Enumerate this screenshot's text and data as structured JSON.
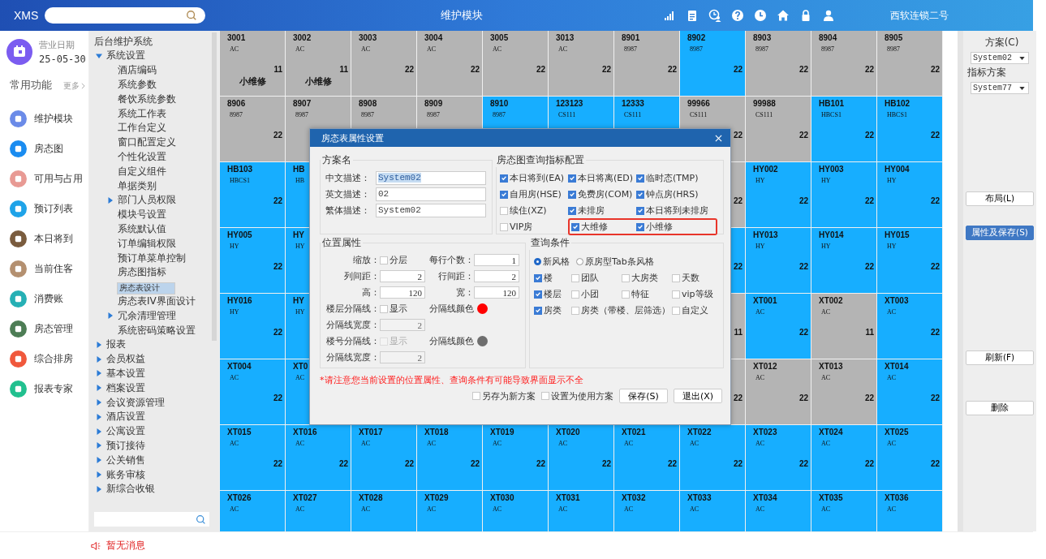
{
  "header": {
    "logo": "XMS",
    "title": "维护模块",
    "user": "西软连锁二号"
  },
  "business_date": {
    "label": "营业日期",
    "value": "25-05-30"
  },
  "shortcuts": {
    "title": "常用功能",
    "more": "更多",
    "items": [
      {
        "label": "维护模块",
        "color": "#6b8be8"
      },
      {
        "label": "房态图",
        "color": "#1a8cf0"
      },
      {
        "label": "可用与占用",
        "color": "#e89a94"
      },
      {
        "label": "预订列表",
        "color": "#1fa3e8"
      },
      {
        "label": "本日将到",
        "color": "#7a5c3e"
      },
      {
        "label": "当前住客",
        "color": "#b49070"
      },
      {
        "label": "消费账",
        "color": "#26b0b5"
      },
      {
        "label": "房态管理",
        "color": "#4d7d55"
      },
      {
        "label": "综合排房",
        "color": "#f0583c"
      },
      {
        "label": "报表专家",
        "color": "#22c08f"
      }
    ]
  },
  "tree": {
    "root": "后台维护系统",
    "items": [
      {
        "label": "系统设置",
        "kind": "branch",
        "expanded": true,
        "selected": false,
        "children": [
          {
            "label": "酒店编码",
            "kind": "leaf",
            "selected": false
          },
          {
            "label": "系统参数",
            "kind": "leaf",
            "selected": false
          },
          {
            "label": "餐饮系统参数",
            "kind": "leaf",
            "selected": false
          },
          {
            "label": "系统工作表",
            "kind": "leaf",
            "selected": false
          },
          {
            "label": "工作台定义",
            "kind": "leaf",
            "selected": false
          },
          {
            "label": "窗口配置定义",
            "kind": "leaf",
            "selected": false
          },
          {
            "label": "个性化设置",
            "kind": "leaf",
            "selected": false
          },
          {
            "label": "自定义组件",
            "kind": "leaf",
            "selected": false
          },
          {
            "label": "单据类别",
            "kind": "leaf",
            "selected": false
          },
          {
            "label": "部门人员权限",
            "kind": "branch",
            "expanded": false,
            "selected": false
          },
          {
            "label": "模块号设置",
            "kind": "leaf",
            "selected": false
          },
          {
            "label": "系统默认值",
            "kind": "leaf",
            "selected": false
          },
          {
            "label": "订单编辑权限",
            "kind": "leaf",
            "selected": false
          },
          {
            "label": "预订单菜单控制",
            "kind": "leaf",
            "selected": false
          },
          {
            "label": "房态图指标",
            "kind": "leaf",
            "selected": false
          },
          {
            "label": "房态表设计",
            "kind": "leaf",
            "selected": true
          },
          {
            "label": "房态表IV界面设计",
            "kind": "leaf",
            "selected": false
          },
          {
            "label": "冗余清理管理",
            "kind": "branch",
            "expanded": false,
            "selected": false
          },
          {
            "label": "系统密码策略设置",
            "kind": "leaf",
            "selected": false
          }
        ]
      },
      {
        "label": "报表",
        "kind": "branch",
        "expanded": false,
        "selected": false
      },
      {
        "label": "会员权益",
        "kind": "branch",
        "expanded": false,
        "selected": false
      },
      {
        "label": "基本设置",
        "kind": "branch",
        "expanded": false,
        "selected": false
      },
      {
        "label": "档案设置",
        "kind": "branch",
        "expanded": false,
        "selected": false
      },
      {
        "label": "会议资源管理",
        "kind": "branch",
        "expanded": false,
        "selected": false
      },
      {
        "label": "酒店设置",
        "kind": "branch",
        "expanded": false,
        "selected": false
      },
      {
        "label": "公寓设置",
        "kind": "branch",
        "expanded": false,
        "selected": false
      },
      {
        "label": "预订接待",
        "kind": "branch",
        "expanded": false,
        "selected": false
      },
      {
        "label": "公关销售",
        "kind": "branch",
        "expanded": false,
        "selected": false
      },
      {
        "label": "账务审核",
        "kind": "branch",
        "expanded": false,
        "selected": false
      },
      {
        "label": "新综合收银",
        "kind": "branch",
        "expanded": false,
        "selected": false
      }
    ]
  },
  "grid": {
    "rows": [
      [
        {
          "name": "3001",
          "code": "AC",
          "number": "11",
          "note": "小维修",
          "color": "#b4b4b4"
        },
        {
          "name": "3002",
          "code": "AC",
          "number": "11",
          "note": "小维修",
          "color": "#b4b4b4"
        },
        {
          "name": "3003",
          "code": "AC",
          "number": "22",
          "color": "#b4b4b4"
        },
        {
          "name": "3004",
          "code": "AC",
          "number": "22",
          "color": "#b4b4b4"
        },
        {
          "name": "3005",
          "code": "AC",
          "number": "22",
          "color": "#b4b4b4"
        },
        {
          "name": "3013",
          "code": "AC",
          "number": "22",
          "color": "#b4b4b4"
        },
        {
          "name": "8901",
          "code": "8987",
          "number": "22",
          "color": "#b4b4b4"
        },
        {
          "name": "8902",
          "code": "8987",
          "number": "22",
          "color": "#17aeff"
        },
        {
          "name": "8903",
          "code": "8987",
          "number": "22",
          "color": "#b4b4b4"
        },
        {
          "name": "8904",
          "code": "8987",
          "number": "22",
          "color": "#b4b4b4"
        },
        {
          "name": "8905",
          "code": "8987",
          "number": "22",
          "color": "#b4b4b4"
        }
      ],
      [
        {
          "name": "8906",
          "code": "8987",
          "number": "22",
          "color": "#b4b4b4"
        },
        {
          "name": "8907",
          "code": "8987",
          "color": "#b4b4b4"
        },
        {
          "name": "8908",
          "code": "8987",
          "color": "#b4b4b4"
        },
        {
          "name": "8909",
          "code": "8987",
          "color": "#b4b4b4"
        },
        {
          "name": "8910",
          "code": "8987",
          "color": "#17aeff"
        },
        {
          "name": "123123",
          "code": "CS111",
          "color": "#17aeff"
        },
        {
          "name": "12333",
          "code": "CS111",
          "color": "#17aeff"
        },
        {
          "name": "99966",
          "code": "CS111",
          "number": "22",
          "color": "#b4b4b4"
        },
        {
          "name": "99988",
          "code": "CS111",
          "number": "22",
          "color": "#b4b4b4"
        },
        {
          "name": "HB101",
          "code": "HBCS1",
          "number": "22",
          "color": "#17aeff"
        },
        {
          "name": "HB102",
          "code": "HBCS1",
          "number": "22",
          "color": "#17aeff"
        }
      ],
      [
        {
          "name": "HB103",
          "code": "HBCS1",
          "number": "22",
          "color": "#17aeff"
        },
        {
          "name": "HB",
          "code": "HB",
          "color": "#17aeff"
        },
        {},
        {},
        {},
        {},
        {},
        {
          "number": "22",
          "color": "#b4b4b4"
        },
        {
          "name": "HY002",
          "code": "HY",
          "number": "22",
          "color": "#17aeff"
        },
        {
          "name": "HY003",
          "code": "HY",
          "number": "22",
          "color": "#17aeff"
        },
        {
          "name": "HY004",
          "code": "HY",
          "number": "22",
          "color": "#17aeff"
        }
      ],
      [
        {
          "name": "HY005",
          "code": "HY",
          "number": "22",
          "color": "#17aeff"
        },
        {
          "name": "HY",
          "code": "HY",
          "color": "#17aeff"
        },
        {},
        {},
        {},
        {},
        {},
        {
          "number": "22",
          "color": "#17aeff"
        },
        {
          "name": "HY013",
          "code": "HY",
          "number": "22",
          "color": "#17aeff"
        },
        {
          "name": "HY014",
          "code": "HY",
          "number": "22",
          "color": "#17aeff"
        },
        {
          "name": "HY015",
          "code": "HY",
          "number": "22",
          "color": "#17aeff"
        }
      ],
      [
        {
          "name": "HY016",
          "code": "HY",
          "number": "22",
          "color": "#17aeff"
        },
        {
          "name": "HY",
          "code": "HY",
          "color": "#17aeff"
        },
        {},
        {},
        {},
        {},
        {},
        {
          "number": "11",
          "color": "#b4b4b4"
        },
        {
          "name": "XT001",
          "code": "AC",
          "number": "22",
          "color": "#17aeff"
        },
        {
          "name": "XT002",
          "code": "AC",
          "number": "11",
          "color": "#b4b4b4"
        },
        {
          "name": "XT003",
          "code": "AC",
          "number": "22",
          "color": "#17aeff"
        }
      ],
      [
        {
          "name": "XT004",
          "code": "AC",
          "number": "22",
          "color": "#17aeff"
        },
        {
          "name": "XT0",
          "code": "AC",
          "color": "#17aeff"
        },
        {},
        {},
        {},
        {},
        {},
        {
          "number": "22",
          "color": "#b4b4b4"
        },
        {
          "name": "XT012",
          "code": "AC",
          "number": "22",
          "color": "#b4b4b4"
        },
        {
          "name": "XT013",
          "code": "AC",
          "number": "22",
          "color": "#b4b4b4"
        },
        {
          "name": "XT014",
          "code": "AC",
          "number": "22",
          "color": "#17aeff"
        }
      ],
      [
        {
          "name": "XT015",
          "code": "AC",
          "number": "22",
          "color": "#17aeff"
        },
        {
          "name": "XT016",
          "code": "AC",
          "number": "22",
          "color": "#17aeff"
        },
        {
          "name": "XT017",
          "code": "AC",
          "number": "22",
          "color": "#17aeff"
        },
        {
          "name": "XT018",
          "code": "AC",
          "number": "22",
          "color": "#17aeff"
        },
        {
          "name": "XT019",
          "code": "AC",
          "number": "22",
          "color": "#17aeff"
        },
        {
          "name": "XT020",
          "code": "AC",
          "number": "22",
          "color": "#17aeff"
        },
        {
          "name": "XT021",
          "code": "AC",
          "number": "22",
          "color": "#17aeff"
        },
        {
          "name": "XT022",
          "code": "AC",
          "number": "22",
          "color": "#17aeff"
        },
        {
          "name": "XT023",
          "code": "AC",
          "number": "22",
          "color": "#17aeff"
        },
        {
          "name": "XT024",
          "code": "AC",
          "number": "22",
          "color": "#17aeff"
        },
        {
          "name": "XT025",
          "code": "AC",
          "number": "22",
          "color": "#17aeff"
        }
      ],
      [
        {
          "name": "XT026",
          "code": "AC",
          "color": "#17aeff"
        },
        {
          "name": "XT027",
          "code": "AC",
          "color": "#17aeff"
        },
        {
          "name": "XT028",
          "code": "AC",
          "color": "#17aeff"
        },
        {
          "name": "XT029",
          "code": "AC",
          "color": "#17aeff"
        },
        {
          "name": "XT030",
          "code": "AC",
          "color": "#17aeff"
        },
        {
          "name": "XT031",
          "code": "AC",
          "color": "#17aeff"
        },
        {
          "name": "XT032",
          "code": "AC",
          "color": "#17aeff"
        },
        {
          "name": "XT033",
          "code": "AC",
          "color": "#17aeff"
        },
        {
          "name": "XT034",
          "code": "AC",
          "color": "#17aeff"
        },
        {
          "name": "XT035",
          "code": "AC",
          "color": "#17aeff"
        },
        {
          "name": "XT036",
          "code": "AC",
          "color": "#17aeff"
        }
      ]
    ]
  },
  "side_panel": {
    "scheme_label": "方案(C)",
    "scheme": "System02",
    "index_label": "指标方案",
    "index_scheme": "System77",
    "buttons": [
      {
        "label": "布局(L)",
        "primary": false
      },
      {
        "label": "属性及保存(S)",
        "primary": true
      },
      {
        "label": "刷新(F)",
        "primary": false
      },
      {
        "label": "删除",
        "primary": false
      }
    ]
  },
  "dialog": {
    "title": "房态表属性设置",
    "scheme": {
      "title": "方案名",
      "fields": [
        {
          "label": "中文描述：",
          "value": "System02",
          "selected": true
        },
        {
          "label": "英文描述：",
          "value": "02",
          "selected": false
        },
        {
          "label": "繁体描述：",
          "value": "System02",
          "selected": false
        }
      ]
    },
    "indicators": {
      "title": "房态图查询指标配置",
      "items": [
        {
          "label": "本日将到(EA)",
          "checked": true,
          "highlighted": false
        },
        {
          "label": "本日将离(ED)",
          "checked": true,
          "highlighted": false
        },
        {
          "label": "临时态(TMP)",
          "checked": true,
          "highlighted": false
        },
        {
          "label": "自用房(HSE)",
          "checked": true,
          "highlighted": false
        },
        {
          "label": "免费房(COM)",
          "checked": true,
          "highlighted": false
        },
        {
          "label": "钟点房(HRS)",
          "checked": true,
          "highlighted": false
        },
        {
          "label": "续住(XZ)",
          "checked": false,
          "highlighted": false
        },
        {
          "label": "未排房",
          "checked": true,
          "highlighted": false
        },
        {
          "label": "本日将到未排房",
          "checked": true,
          "highlighted": false
        },
        {
          "label": "VIP房",
          "checked": false,
          "highlighted": false
        },
        {
          "label": "大维修",
          "checked": true,
          "highlighted": true
        },
        {
          "label": "小维修",
          "checked": true,
          "highlighted": true
        }
      ]
    },
    "position": {
      "title": "位置属性",
      "rows": [
        [
          {
            "label": "缩放：",
            "kind": "checkbox",
            "text": "分层",
            "checked": false,
            "disabled": false
          },
          {
            "label": "每行个数：",
            "kind": "input",
            "value": "1",
            "disabled": false
          }
        ],
        [
          {
            "label": "列间距：",
            "kind": "input",
            "value": "2",
            "disabled": false
          },
          {
            "label": "行间距：",
            "kind": "input",
            "value": "2",
            "disabled": false
          }
        ],
        [
          {
            "label": "高：",
            "kind": "input",
            "value": "120",
            "disabled": false
          },
          {
            "label": "宽：",
            "kind": "input",
            "value": "120",
            "disabled": false
          }
        ],
        [
          {
            "label": "楼层分隔线：",
            "kind": "checkbox",
            "text": "显示",
            "checked": false,
            "disabled": false
          },
          {
            "label": "分隔线颜色",
            "kind": "color",
            "color": "#ff0000"
          }
        ],
        [
          {
            "label": "分隔线宽度：",
            "kind": "input",
            "value": "2",
            "disabled": true
          }
        ],
        [
          {
            "label": "楼号分隔线：",
            "kind": "checkbox",
            "text": "显示",
            "checked": false,
            "disabled": true
          },
          {
            "label": "分隔线颜色",
            "kind": "color",
            "color": "#6e6e6e"
          }
        ],
        [
          {
            "label": "分隔线宽度：",
            "kind": "input",
            "value": "2",
            "disabled": true
          }
        ]
      ]
    },
    "query": {
      "title": "查询条件",
      "styles": [
        {
          "label": "新风格",
          "selected": true
        },
        {
          "label": "原房型Tab条风格",
          "selected": false
        }
      ],
      "items": [
        {
          "label": "楼",
          "checked": true
        },
        {
          "label": "团队",
          "checked": false
        },
        {
          "label": "大房类",
          "checked": false
        },
        {
          "label": "天数",
          "checked": false
        },
        {
          "label": "楼层",
          "checked": true
        },
        {
          "label": "小团",
          "checked": false
        },
        {
          "label": "特征",
          "checked": false
        },
        {
          "label": "vip等级",
          "checked": false
        },
        {
          "label": "房类",
          "checked": true
        },
        {
          "label": "房类（带楼、层筛选）",
          "checked": false
        },
        {
          "label": "自定义",
          "checked": false
        }
      ]
    },
    "warning": "*请注意您当前设置的位置属性、查询条件有可能导致界面显示不全",
    "options": [
      {
        "label": "另存为新方案",
        "checked": false
      },
      {
        "label": "设置为使用方案",
        "checked": false
      }
    ],
    "buttons": [
      "保存(S)",
      "退出(X)"
    ]
  },
  "status_bar": {
    "message": "暂无消息"
  }
}
